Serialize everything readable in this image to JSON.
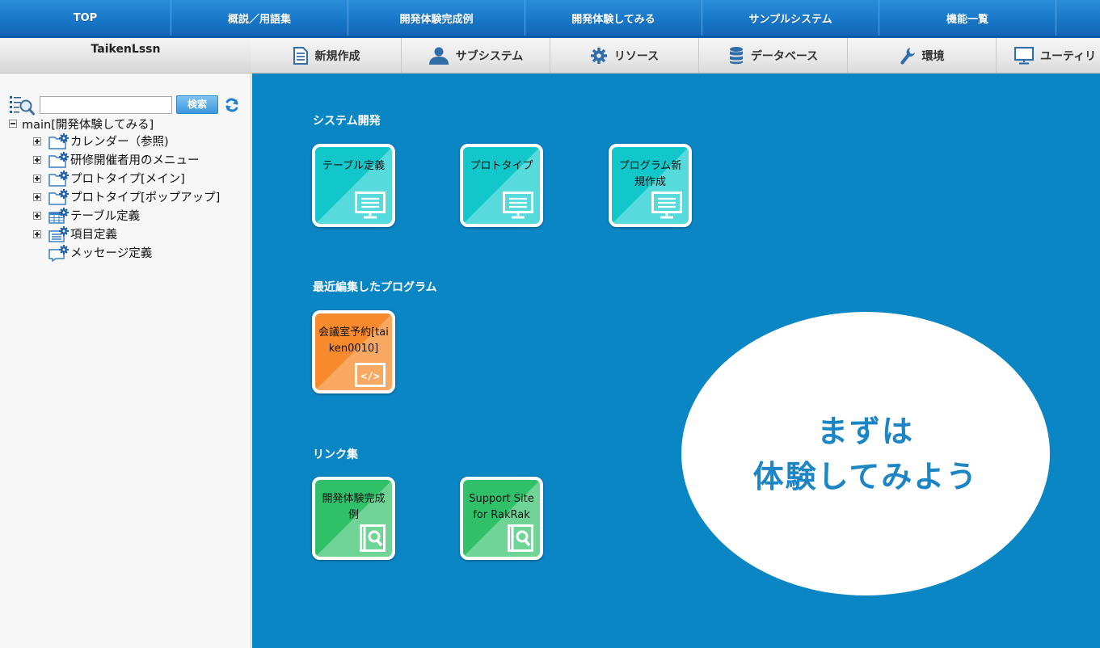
{
  "topnav": {
    "items": [
      "TOP",
      "概説／用語集",
      "開発体験完成例",
      "開発体験してみる",
      "サンプルシステム",
      "機能一覧",
      ""
    ]
  },
  "sidebar": {
    "title": "TaikenLssn",
    "search": {
      "value": "",
      "placeholder": "",
      "button_label": "検索"
    },
    "tree": {
      "root_label": "main[開発体験してみる]",
      "items": [
        {
          "label": "カレンダー（参照)",
          "expandable": true,
          "icon": "folder-gear-icon"
        },
        {
          "label": "研修開催者用のメニュー",
          "expandable": true,
          "icon": "folder-gear-icon"
        },
        {
          "label": "プロトタイプ[メイン]",
          "expandable": true,
          "icon": "folder-gear-icon"
        },
        {
          "label": "プロトタイプ[ポップアップ]",
          "expandable": true,
          "icon": "folder-gear-icon"
        },
        {
          "label": "テーブル定義",
          "expandable": true,
          "icon": "table-gear-icon"
        },
        {
          "label": "項目定義",
          "expandable": true,
          "icon": "list-gear-icon"
        },
        {
          "label": "メッセージ定義",
          "expandable": false,
          "icon": "message-gear-icon"
        }
      ]
    }
  },
  "subnav": {
    "items": [
      {
        "label": "新規作成",
        "icon": "document-icon"
      },
      {
        "label": "サブシステム",
        "icon": "user-icon"
      },
      {
        "label": "リソース",
        "icon": "gear-icon"
      },
      {
        "label": "データベース",
        "icon": "database-icon"
      },
      {
        "label": "環境",
        "icon": "wrench-icon"
      },
      {
        "label": "ユーティリ",
        "icon": "monitor-icon"
      }
    ]
  },
  "main": {
    "sections": {
      "dev": {
        "title": "システム開発",
        "tiles": [
          {
            "label": "テーブル定義",
            "icon": "monitor-icon"
          },
          {
            "label": "プロトタイプ",
            "icon": "monitor-icon"
          },
          {
            "label": "プログラム新規作成",
            "icon": "monitor-icon"
          }
        ]
      },
      "recent": {
        "title": "最近編集したプログラム",
        "tiles": [
          {
            "label": "会議室予約[taiken0010]",
            "icon": "code-icon"
          }
        ]
      },
      "links": {
        "title": "リンク集",
        "tiles": [
          {
            "label": "開発体験完成例",
            "icon": "book-search-icon"
          },
          {
            "label": "Support Site for RakRak",
            "icon": "book-search-icon"
          }
        ]
      }
    },
    "bubble": {
      "line1": "まずは",
      "line2": "体験してみよう"
    }
  },
  "colors": {
    "topnav": "#1877c9",
    "main_background": "#0b86c5",
    "tile_teal": "#12c7c9",
    "tile_orange": "#f68a2c",
    "tile_green": "#30c06a",
    "bubble_text": "#1b85c6"
  }
}
